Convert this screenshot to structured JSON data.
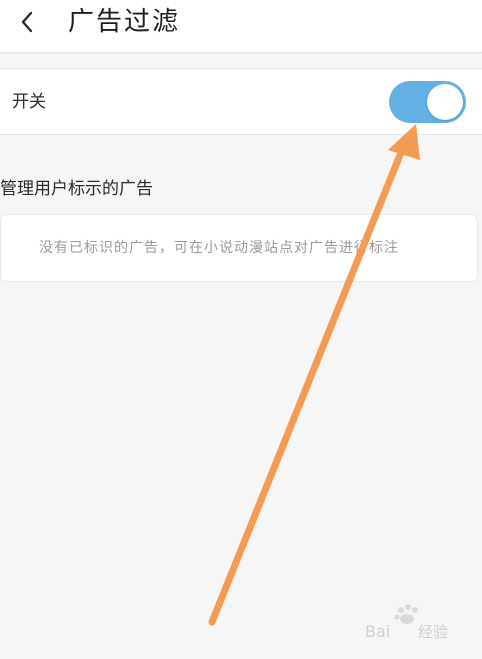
{
  "header": {
    "title": "广告过滤",
    "back_icon": "chevron-left-icon"
  },
  "switch_row": {
    "label": "开关",
    "state": "on",
    "accent_color": "#63b0e6"
  },
  "ads_section": {
    "title": "管理用户标示的广告",
    "empty_message": "没有已标识的广告，可在小说动漫站点对广告进行标注"
  },
  "annotation": {
    "arrow_color": "#f59a52"
  },
  "watermark": {
    "text": "Bai du 经验"
  }
}
